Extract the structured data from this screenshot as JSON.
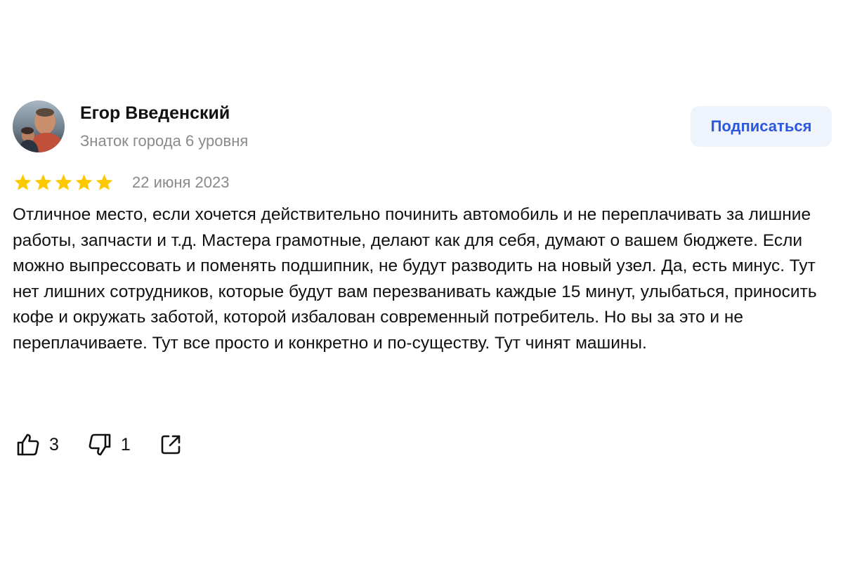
{
  "author": {
    "name": "Егор Введенский",
    "level": "Знаток города 6 уровня"
  },
  "subscribe_button": {
    "label": "Подписаться"
  },
  "review": {
    "rating": 5,
    "max_rating": 5,
    "date": "22 июня 2023",
    "text": "Отличное место, если хочется действительно починить автомобиль и не переплачивать за лишние работы, запчасти и т.д. Мастера грамотные, делают как для себя, думают о вашем бюджете. Если можно выпрессовать и поменять подшипник, не будут разводить на новый узел. Да, есть минус. Тут нет лишних сотрудников, которые будут вам перезванивать каждые 15 минут, улыбаться, приносить кофе и окружать заботой, которой избалован современный потребитель. Но вы за это и не переплачиваете. Тут все просто и конкретно и по-существу. Тут чинят машины."
  },
  "reactions": {
    "likes": "3",
    "dislikes": "1"
  },
  "icons": {
    "star": "star-icon",
    "like": "thumbs-up-icon",
    "dislike": "thumbs-down-icon",
    "share": "share-icon"
  },
  "colors": {
    "star": "#fcc800",
    "accent": "#2c57e0",
    "button_bg": "#eef3fc",
    "muted_text": "#8a8a8a"
  }
}
